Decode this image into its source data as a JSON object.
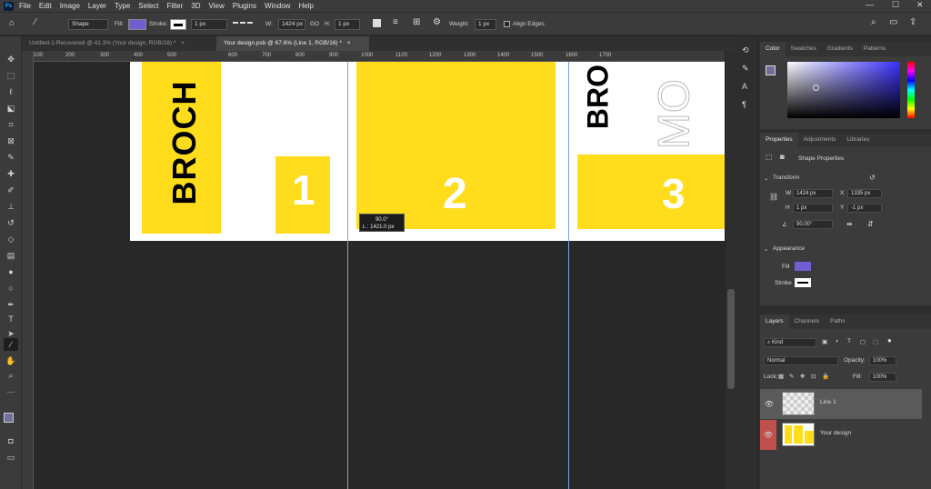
{
  "menu": {
    "logo": "Ps",
    "items": [
      "File",
      "Edit",
      "Image",
      "Layer",
      "Type",
      "Select",
      "Filter",
      "3D",
      "View",
      "Plugins",
      "Window",
      "Help"
    ],
    "window_controls": [
      "—",
      "☐",
      "✕"
    ]
  },
  "options_bar": {
    "mode": "Shape",
    "fill_label": "Fill:",
    "stroke_label": "Stroke:",
    "stroke_width": "1 px",
    "w_label": "W:",
    "w_value": "1424 px",
    "link": "GO",
    "h_label": "H:",
    "h_value": "1 px",
    "weight_label": "Weight:",
    "weight_value": "1 px",
    "align_edges": "Align Edges",
    "fill_color": "#6f5fd3"
  },
  "tabs": [
    {
      "label": "Untitled-1-Recovered @ 41.3% (Your design, RGB/16) *",
      "close": "×"
    },
    {
      "label": "Your design.psb @ 67.6% (Line 1, RGB/16) *",
      "close": "×"
    }
  ],
  "ruler": {
    "labels": [
      "100",
      "200",
      "300",
      "400",
      "500",
      "600",
      "700",
      "800",
      "900",
      "1000",
      "1100",
      "1200",
      "1300",
      "1400",
      "1500",
      "1600",
      "1700"
    ]
  },
  "canvas": {
    "brochure_text_left": "BROCH",
    "brochure_text_right": "BRO",
    "mo_text": "MO",
    "panel1": "1",
    "panel2": "2",
    "panel3": "3",
    "tooltip_line1": "90.0°",
    "tooltip_line2": "L : 1421.0 px",
    "accent_yellow": "#ffdd1c"
  },
  "color_panel": {
    "tabs": [
      "Color",
      "Swatches",
      "Gradients",
      "Patterns"
    ],
    "foreground": "#6f6f9a",
    "hue": "#3b30ff"
  },
  "properties_panel": {
    "tabs": [
      "Properties",
      "Adjustments",
      "Libraries"
    ],
    "shape_properties": "Shape Properties",
    "transform_label": "Transform",
    "w_label": "W",
    "w_value": "1424 px",
    "x_label": "X",
    "x_value": "1335 px",
    "h_label": "H",
    "h_value": "1 px",
    "y_label": "Y",
    "y_value": "-1 px",
    "angle_value": "90.00°",
    "appearance_label": "Appearance",
    "fill_label": "Fill",
    "stroke_label": "Stroke"
  },
  "layers_panel": {
    "tabs": [
      "Layers",
      "Channels",
      "Paths"
    ],
    "kind": "Kind",
    "blend_mode": "Normal",
    "opacity_label": "Opacity:",
    "opacity_value": "100%",
    "lock_label": "Lock:",
    "fill_label": "Fill:",
    "fill_value": "100%",
    "layers": [
      {
        "name": "Line 1"
      },
      {
        "name": "Your design"
      }
    ]
  }
}
